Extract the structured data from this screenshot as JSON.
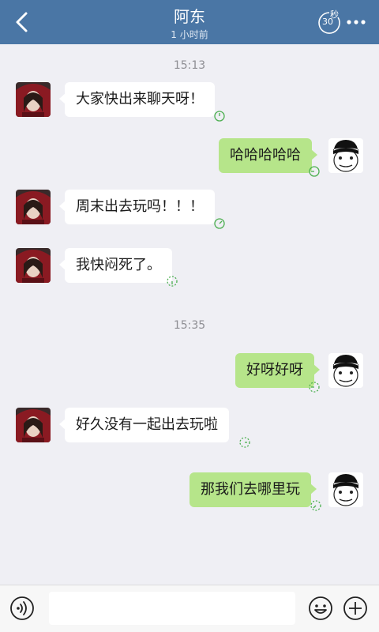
{
  "header": {
    "title": "阿东",
    "subtitle": "1 小时前",
    "timer_unit": "秒",
    "timer_value": "30"
  },
  "messages": {
    "ts1": "15:13",
    "m1": "大家快出来聊天呀！",
    "m2": "哈哈哈哈哈",
    "m3": "周末出去玩吗！！！",
    "m4": "我快闷死了。",
    "ts2": "15:35",
    "m5": "好呀好呀",
    "m6": "好久没有一起出去玩啦",
    "m7": "那我们去哪里玩"
  },
  "input": {
    "placeholder": "",
    "value": ""
  },
  "colors": {
    "header": "#4a76a5",
    "outgoing_bubble": "#b6e58a",
    "incoming_bubble": "#ffffff",
    "background": "#efeff4"
  },
  "icons": {
    "back": "chevron-left-icon",
    "timer": "countdown-timer-icon",
    "more": "more-icon",
    "voice": "voice-icon",
    "emoji": "emoji-icon",
    "plus": "plus-icon",
    "status": "burn-timer-icon"
  }
}
